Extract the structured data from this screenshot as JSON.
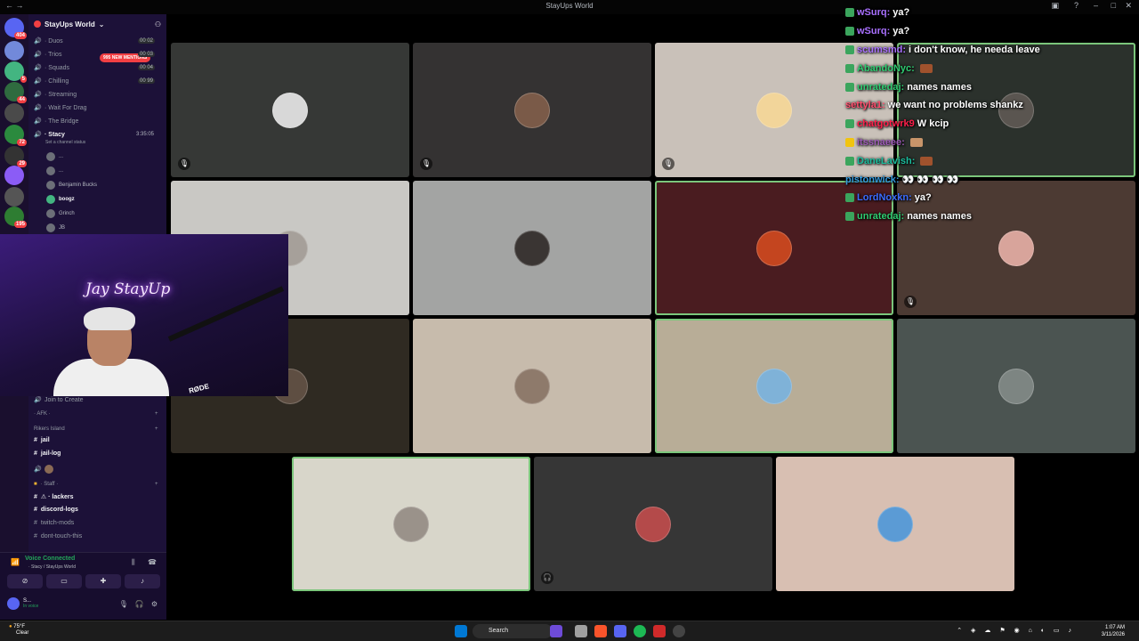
{
  "window": {
    "title": "StayUps World"
  },
  "rail": {
    "top_badge": "404",
    "badges": [
      "5",
      "44",
      "72",
      "29",
      "195"
    ]
  },
  "sidebar": {
    "guild_name": "StayUps World",
    "mention_pill": "995 NEW MENTIONS",
    "channels": [
      {
        "label": "· Duos",
        "count": "00 02"
      },
      {
        "label": "· Trios",
        "count": "00 03"
      },
      {
        "label": "· Squads",
        "count": "00 04"
      },
      {
        "label": "· Chilling",
        "count": "00 99"
      },
      {
        "label": "· Streaming",
        "count": ""
      },
      {
        "label": "· Wait For Drag",
        "count": ""
      },
      {
        "label": "· The Bridge",
        "count": ""
      }
    ],
    "active_channel": {
      "label": "· Stacy",
      "time": "3:35:05",
      "status": "Set a channel status"
    },
    "members": [
      "...",
      "...",
      "Benjamin Bucks",
      "boogz",
      "Grinch",
      "JB"
    ],
    "join_to_create": "Join to Create",
    "afk": "· AFK ·",
    "rikers": "Rikers Island",
    "text_channels": [
      "jail",
      "jail-log"
    ],
    "staff": "· Staff ·",
    "staff_channels": [
      "⚠ · lackers",
      "discord-logs",
      "twitch-mods",
      "dont-touch-this"
    ]
  },
  "voice": {
    "status": "Voice Connected",
    "location": "· Stacy / StayUps World"
  },
  "user": {
    "name": "S...",
    "status": "In voice"
  },
  "webcam": {
    "neon_text": "Jay StayUp",
    "mic_brand": "RØDE"
  },
  "chat": {
    "messages": [
      {
        "user": "wSurq:",
        "text": "ya?",
        "color": "#a970ff"
      },
      {
        "user": "wSurq:",
        "text": "ya?",
        "color": "#a970ff"
      },
      {
        "user": "scumsmd:",
        "text": "i don't know, he needa leave",
        "color": "#a970ff"
      },
      {
        "user": "AbandoNyc:",
        "text": "",
        "color": "#2ecc71"
      },
      {
        "user": "unratedaj:",
        "text": "names names",
        "color": "#2ecc71"
      },
      {
        "user": "settyla1:",
        "text": "we want no problems shankz",
        "color": "#ff4d6d"
      },
      {
        "user": "chatgotwrk9",
        "text": "W kcip",
        "color": "#ff1f4b"
      },
      {
        "user": "itssnaeee:",
        "text": "",
        "color": "#9b59b6"
      },
      {
        "user": "DaneLavish:",
        "text": "",
        "color": "#1abc9c"
      },
      {
        "user": "pistonwick:",
        "text": "👀 👀 👀 👀",
        "color": "#3498db"
      },
      {
        "user": "LordNoxkn:",
        "text": "ya?",
        "color": "#3b6cff"
      },
      {
        "user": "unratedaj:",
        "text": "names names",
        "color": "#2ecc71"
      }
    ]
  },
  "taskbar": {
    "weather_temp": "75°F",
    "weather_desc": "Clear",
    "search_placeholder": "Search",
    "time": "1:07 AM",
    "date": "3/11/2026"
  }
}
